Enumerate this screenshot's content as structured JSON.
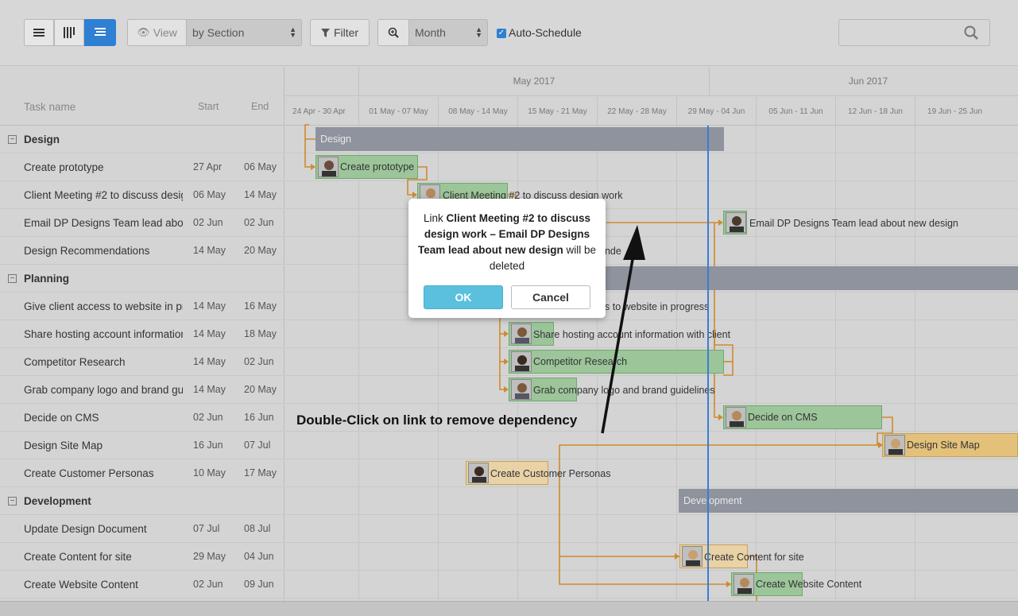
{
  "toolbar": {
    "view_label": "View",
    "group_by": "by Section",
    "filter_label": "Filter",
    "scale": "Month",
    "auto_schedule_label": "Auto-Schedule",
    "auto_schedule_checked": true,
    "search_placeholder": ""
  },
  "grid": {
    "header": {
      "task": "Task name",
      "start": "Start",
      "end": "End"
    },
    "rows": [
      {
        "type": "section",
        "name": "Design"
      },
      {
        "type": "task",
        "name": "Create prototype",
        "start": "27 Apr",
        "end": "06 May"
      },
      {
        "type": "task",
        "name": "Client Meeting #2 to discuss design work",
        "start": "06 May",
        "end": "14 May"
      },
      {
        "type": "task",
        "name": "Email DP Designs Team lead about new design",
        "start": "02 Jun",
        "end": "02 Jun"
      },
      {
        "type": "task",
        "name": "Design Recommendations",
        "start": "14 May",
        "end": "20 May"
      },
      {
        "type": "section",
        "name": "Planning"
      },
      {
        "type": "task",
        "name": "Give client access to website in progress",
        "start": "14 May",
        "end": "16 May"
      },
      {
        "type": "task",
        "name": "Share hosting account information with client",
        "start": "14 May",
        "end": "18 May"
      },
      {
        "type": "task",
        "name": "Competitor Research",
        "start": "14 May",
        "end": "02 Jun"
      },
      {
        "type": "task",
        "name": "Grab company logo and brand guidelines",
        "start": "14 May",
        "end": "20 May"
      },
      {
        "type": "task",
        "name": "Decide on CMS",
        "start": "02 Jun",
        "end": "16 Jun"
      },
      {
        "type": "task",
        "name": "Design Site Map",
        "start": "16 Jun",
        "end": "07 Jul"
      },
      {
        "type": "task",
        "name": "Create Customer Personas",
        "start": "10 May",
        "end": "17 May"
      },
      {
        "type": "section",
        "name": "Development"
      },
      {
        "type": "task",
        "name": "Update Design Document",
        "start": "07 Jul",
        "end": "08 Jul"
      },
      {
        "type": "task",
        "name": "Create Content for site",
        "start": "29 May",
        "end": "04 Jun"
      },
      {
        "type": "task",
        "name": "Create Website Content",
        "start": "02 Jun",
        "end": "09 Jun"
      }
    ]
  },
  "timeline": {
    "months": [
      "May 2017",
      "Jun 2017"
    ],
    "weeks": [
      "24 Apr - 30 Apr",
      "01 May - 07 May",
      "08 May - 14 May",
      "15 May - 21 May",
      "22 May - 28 May",
      "29 May - 04 Jun",
      "05 Jun - 11 Jun",
      "12 Jun - 18 Jun",
      "19 Jun - 25 Jun"
    ]
  },
  "bars": {
    "design_summary": "Design",
    "create_prototype": "Create prototype",
    "client_meeting": "Client Meeting #2 to discuss design work",
    "email_dp": "Email DP Designs Team lead about new design",
    "design_recs": "Design Recommendations",
    "give_access": "Give client access to website in progress",
    "share_hosting": "Share hosting account information with client",
    "competitor": "Competitor Research",
    "grab_logo": "Grab company logo and brand guidelines",
    "decide_cms": "Decide on CMS",
    "site_map": "Design Site Map",
    "personas": "Create Customer Personas",
    "development_summary": "Development",
    "content_site": "Create Content for site",
    "website_content": "Create Website Content"
  },
  "modal": {
    "prefix": "Link ",
    "bold_text": "Client Meeting #2 to discuss design work – Email DP Designs Team lead about new design",
    "suffix": " will be deleted",
    "ok_label": "OK",
    "cancel_label": "Cancel"
  },
  "annotation": "Double-Click on link to remove dependency",
  "colors": {
    "accent": "#2f7fd2",
    "ok_button": "#5bc0de",
    "summary_bar": "#8e939e",
    "task_green": "#9cc59a",
    "task_orange": "#e3c17a",
    "link": "#d08a2e",
    "today_line": "#3a7dd4"
  }
}
